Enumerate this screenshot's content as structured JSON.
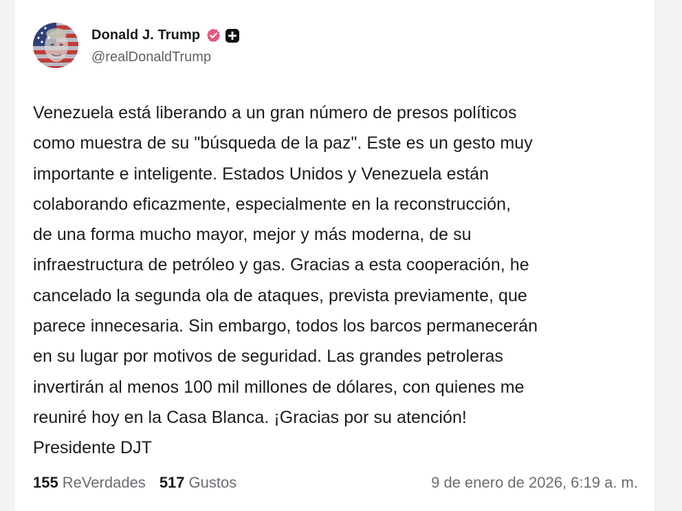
{
  "post": {
    "author": {
      "display_name": "Donald J. Trump",
      "handle": "@realDonaldTrump",
      "avatar_icon": "flag-portrait-avatar",
      "verified_icon": "verified-badge-icon",
      "plus_icon": "plus-badge-icon"
    },
    "text": "Venezuela está liberando a un gran número de presos políticos\ncomo muestra de su \"búsqueda de la paz\". Este es un gesto muy\nimportante e inteligente. Estados Unidos y Venezuela están\ncolaborando eficazmente, especialmente en la reconstrucción,\nde una forma mucho mayor, mejor y más moderna, de su\ninfraestructura de petróleo y gas. Gracias a esta cooperación, he\ncancelado la segunda ola de ataques, prevista previamente, que\nparece innecesaria. Sin embargo, todos los barcos permanecerán\nen su lugar por motivos de seguridad. Las grandes petroleras\ninvertirán al menos 100 mil millones de dólares, con quienes me\nreuniré hoy en la Casa Blanca. ¡Gracias por su atención!\nPresidente DJT",
    "stats": {
      "reposts_count": "155",
      "reposts_label": "ReVerdades",
      "likes_count": "517",
      "likes_label": "Gustos"
    },
    "timestamp": "9 de enero de 2026, 6:19 a. m."
  },
  "colors": {
    "verified_badge": "#e4577e",
    "text_primary": "#1c1c1e",
    "text_secondary": "#6b6b73"
  }
}
